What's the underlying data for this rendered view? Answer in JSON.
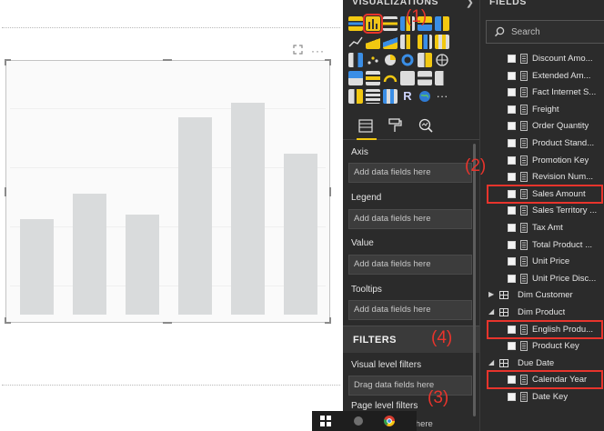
{
  "visualizations": {
    "title": "VISUALIZATIONS",
    "collapse_icon": "chevron-right-icon",
    "wells": [
      {
        "label": "Axis",
        "placeholder": "Add data fields here"
      },
      {
        "label": "Legend",
        "placeholder": "Add data fields here"
      },
      {
        "label": "Value",
        "placeholder": "Add data fields here"
      },
      {
        "label": "Tooltips",
        "placeholder": "Add data fields here"
      }
    ],
    "tabs": [
      "fields-tab-icon",
      "format-paintroller-icon",
      "analytics-magnifier-icon"
    ]
  },
  "filters": {
    "title": "FILTERS",
    "visual_level": "Visual level filters",
    "visual_level_drop": "Drag data fields here",
    "page_level": "Page level filters",
    "page_level_drop": "lds here"
  },
  "fields": {
    "title": "FIELDS",
    "search_placeholder": "Search",
    "items": [
      {
        "label": "Discount Amo...",
        "type": "field"
      },
      {
        "label": "Extended Am...",
        "type": "field"
      },
      {
        "label": "Fact Internet S...",
        "type": "field"
      },
      {
        "label": "Freight",
        "type": "field"
      },
      {
        "label": "Order Quantity",
        "type": "field"
      },
      {
        "label": "Product Stand...",
        "type": "field"
      },
      {
        "label": "Promotion Key",
        "type": "field"
      },
      {
        "label": "Revision Num...",
        "type": "field"
      },
      {
        "label": "Sales Amount",
        "type": "field"
      },
      {
        "label": "Sales Territory ...",
        "type": "field"
      },
      {
        "label": "Tax Amt",
        "type": "field"
      },
      {
        "label": "Total Product ...",
        "type": "field"
      },
      {
        "label": "Unit Price",
        "type": "field"
      },
      {
        "label": "Unit Price Disc...",
        "type": "field"
      },
      {
        "label": "Dim Customer",
        "type": "table-collapsed"
      },
      {
        "label": "Dim Product",
        "type": "table-expanded"
      },
      {
        "label": "English Produ...",
        "type": "field"
      },
      {
        "label": "Product Key",
        "type": "field"
      },
      {
        "label": "Due Date",
        "type": "table-expanded"
      },
      {
        "label": "Calendar Year",
        "type": "field"
      },
      {
        "label": "Date Key",
        "type": "field"
      }
    ]
  },
  "annotations": [
    "(1)",
    "(2)",
    "(3)",
    "(4)"
  ],
  "visual": {
    "focus_icon": "focus-mode-icon",
    "more_icon": "ellipsis-icon",
    "more_glyph": "···",
    "bar_levels": [
      0.45,
      0.57,
      0.47,
      0.93,
      1.0,
      0.76
    ]
  },
  "colors": {
    "accent_yellow": "#f2c811",
    "annotation_red": "#e8342c",
    "pane_background": "#2b2b2b",
    "bar_placeholder": "#d9dbdc"
  }
}
